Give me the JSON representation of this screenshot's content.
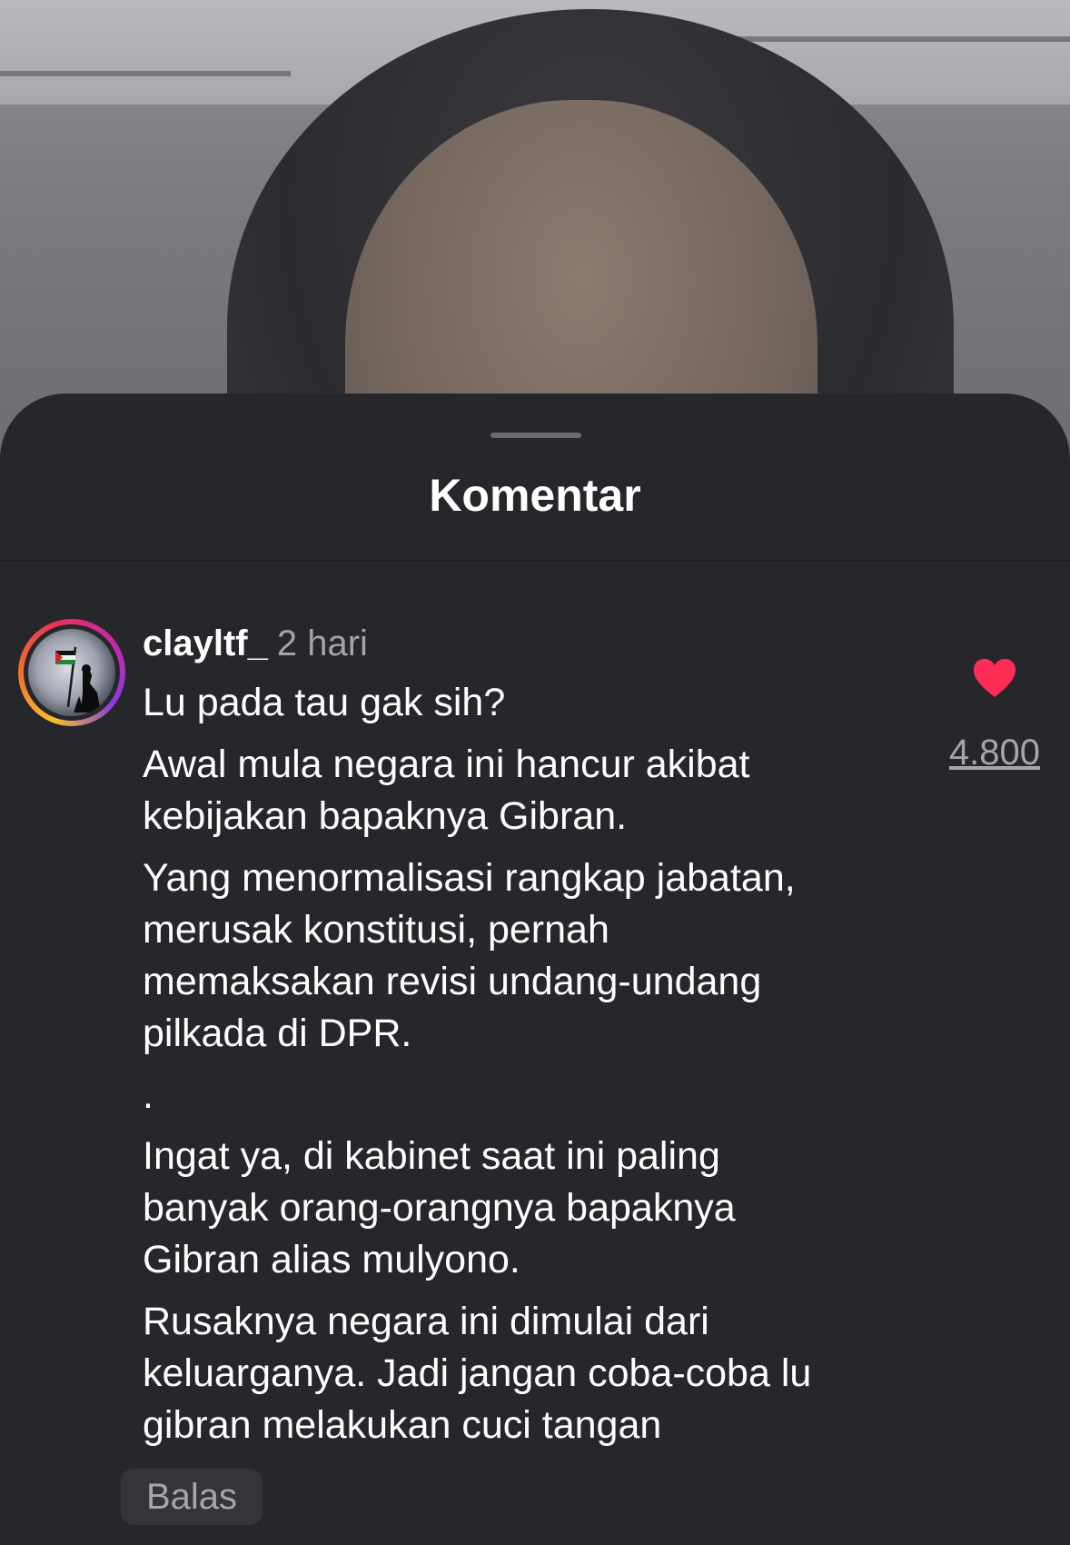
{
  "sheet": {
    "title": "Komentar"
  },
  "comment": {
    "username": "clayltf_",
    "time": "2 hari",
    "paragraphs": [
      [
        "Lu pada tau gak sih?"
      ],
      [
        "Awal mula negara ini hancur akibat",
        "kebijakan bapaknya Gibran."
      ],
      [
        "Yang menormalisasi rangkap jabatan,",
        "merusak konstitusi, pernah",
        "memaksakan revisi undang-undang",
        "pilkada di DPR."
      ],
      [
        "."
      ],
      [
        "Ingat ya, di kabinet saat ini paling",
        "banyak orang-orangnya bapaknya",
        "Gibran alias mulyono."
      ],
      [
        "Rusaknya negara ini dimulai dari",
        "keluarganya. Jadi jangan coba-coba lu",
        "gibran melakukan cuci tangan"
      ]
    ],
    "reply_label": "Balas",
    "like_count": "4.800",
    "like_icon": "heart-icon",
    "like_color": "#ff2d55"
  }
}
